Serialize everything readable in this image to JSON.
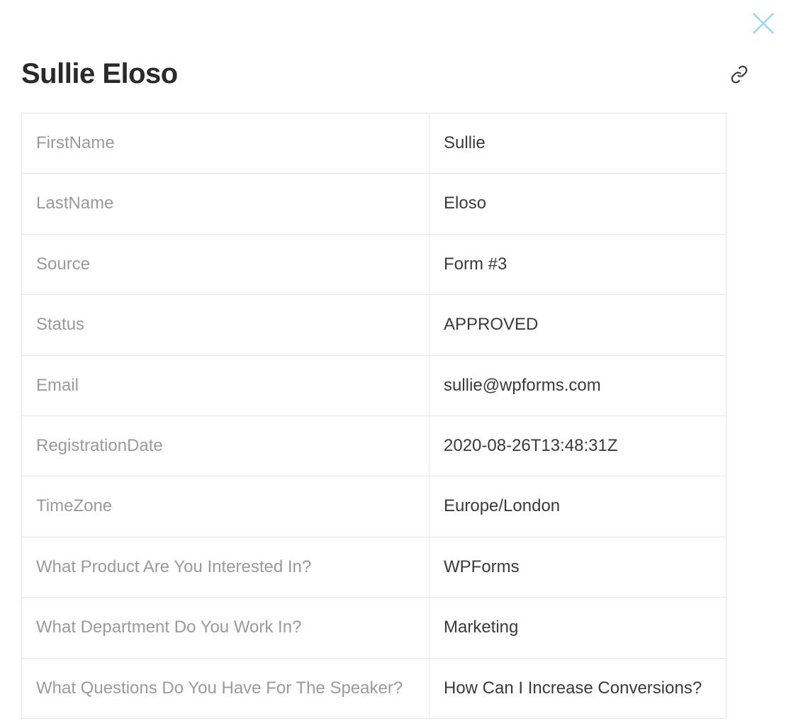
{
  "title": "Sullie Eloso",
  "rows": [
    {
      "label": "FirstName",
      "value": "Sullie"
    },
    {
      "label": "LastName",
      "value": "Eloso"
    },
    {
      "label": "Source",
      "value": "Form #3"
    },
    {
      "label": "Status",
      "value": "APPROVED"
    },
    {
      "label": "Email",
      "value": "sullie@wpforms.com"
    },
    {
      "label": "RegistrationDate",
      "value": "2020-08-26T13:48:31Z"
    },
    {
      "label": "TimeZone",
      "value": "Europe/London"
    },
    {
      "label": "What Product Are You Interested In?",
      "value": "WPForms"
    },
    {
      "label": "What Department Do You Work In?",
      "value": "Marketing"
    },
    {
      "label": "What Questions Do You Have For The Speaker?",
      "value": "How Can I Increase Conversions?"
    }
  ]
}
